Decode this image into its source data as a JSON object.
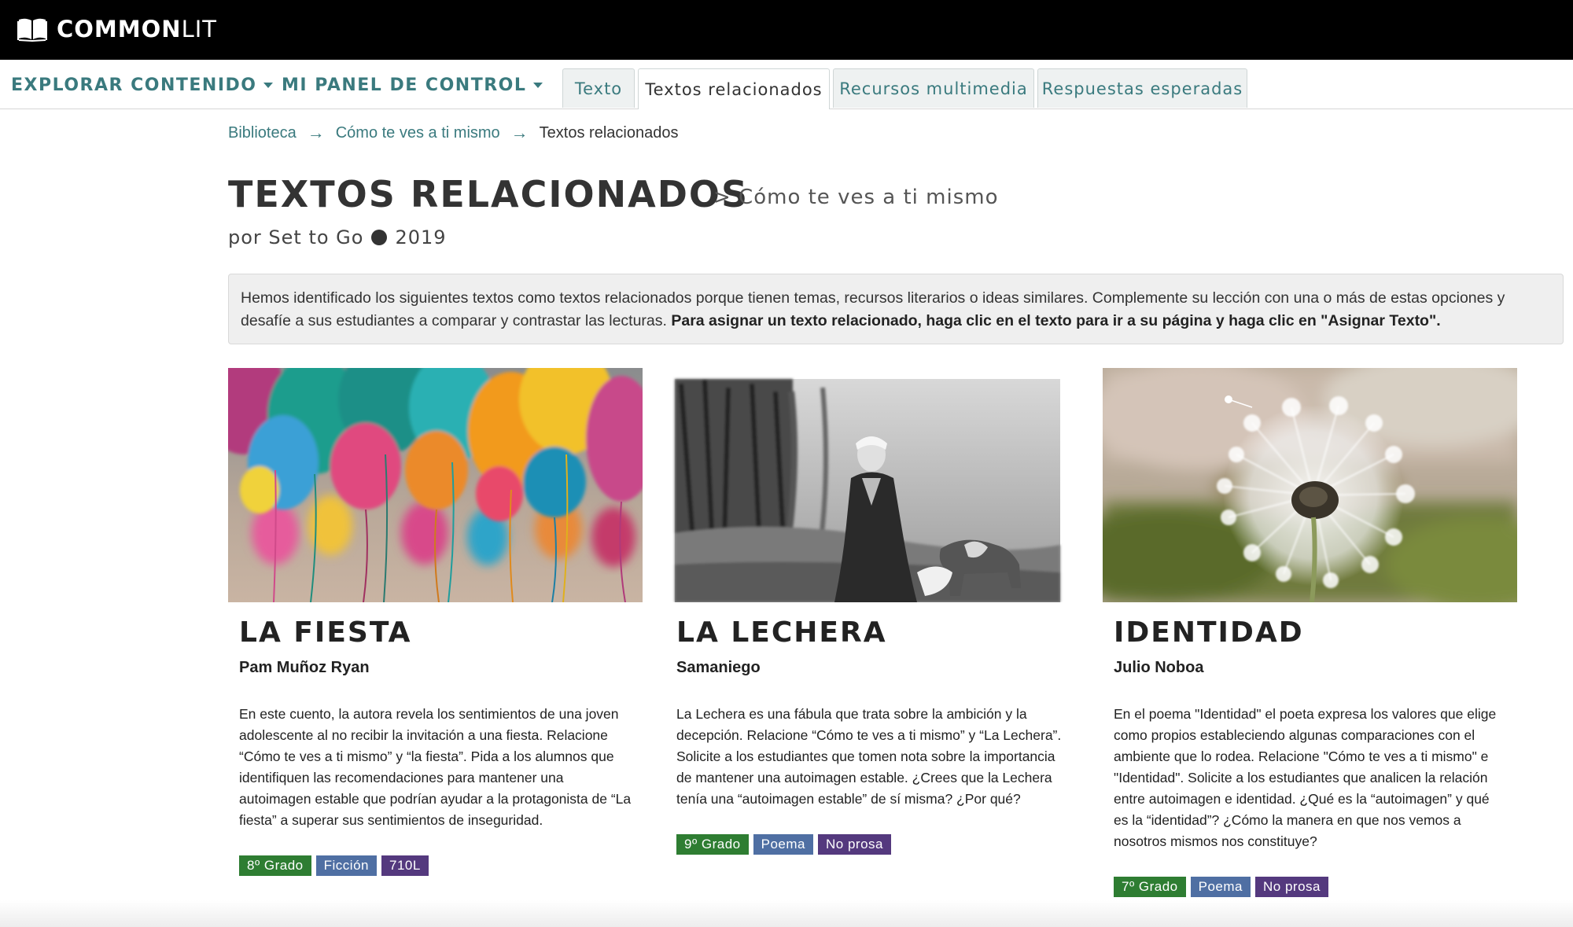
{
  "header": {
    "logo_bold": "COMMON",
    "logo_light": "LIT"
  },
  "nav": {
    "menu1": "EXPLORAR CONTENIDO",
    "menu2": "MI PANEL DE CONTROL",
    "tabs": [
      {
        "label": "Texto",
        "active": false
      },
      {
        "label": "Textos relacionados",
        "active": true
      },
      {
        "label": "Recursos multimedia",
        "active": false
      },
      {
        "label": "Respuestas esperadas",
        "active": false
      }
    ]
  },
  "breadcrumb": {
    "items": [
      "Biblioteca",
      "Cómo te ves a ti mismo",
      "Textos relacionados"
    ]
  },
  "page": {
    "title": "TEXTOS RELACIONADOS",
    "subtitle": "> Cómo te ves a ti mismo",
    "by": "por Set to Go",
    "year": "2019"
  },
  "info": {
    "text": "Hemos identificado los siguientes textos como textos relacionados porque tienen temas, recursos literarios o ideas similares. Complemente su lección con una o más de estas opciones y desafíe a sus estudiantes a comparar y contrastar las lecturas. ",
    "bold": "Para asignar un texto relacionado, haga clic en el texto para ir a su página y haga clic en \"Asignar Texto\"."
  },
  "cards": [
    {
      "title": "LA FIESTA",
      "author": "Pam Muñoz Ryan",
      "description": "En este cuento, la autora revela los sentimientos de una joven adolescente al no recibir la invitación a una fiesta. Relacione “Cómo te ves a ti mismo” y “la fiesta”. Pida a los alumnos que identifiquen las recomendaciones para mantener una autoimagen estable que podrían ayudar a la protagonista de “La fiesta” a superar sus sentimientos de inseguridad.",
      "tags": [
        "8º Grado",
        "Ficción",
        "710L"
      ]
    },
    {
      "title": "LA LECHERA",
      "author": "Samaniego",
      "description": "La Lechera es una fábula que trata sobre la ambición y la decepción. Relacione “Cómo te ves a ti mismo” y “La Lechera”. Solicite a los estudiantes que tomen nota sobre la importancia de mantener una autoimagen estable. ¿Crees que la Lechera tenía una “autoimagen estable” de sí misma? ¿Por qué?",
      "tags": [
        "9º Grado",
        "Poema",
        "No prosa"
      ]
    },
    {
      "title": "IDENTIDAD",
      "author": "Julio Noboa",
      "description": "En el poema \"Identidad\" el poeta expresa los valores que elige como propios estableciendo algunas comparaciones con el ambiente que lo rodea. Relacione \"Cómo te ves a ti mismo\" e \"Identidad\". Solicite a los estudiantes que analicen la relación entre autoimagen e identidad. ¿Qué es la “autoimagen” y qué es la “identidad”? ¿Cómo la manera en que nos vemos a nosotros mismos nos constituye?",
      "tags": [
        "7º Grado",
        "Poema",
        "No prosa"
      ]
    }
  ],
  "colors": {
    "teal": "#3a7a7e",
    "grade_tag": "#2e7d32",
    "genre_tag": "#4f6fa3",
    "extra_tag": "#54397e"
  }
}
